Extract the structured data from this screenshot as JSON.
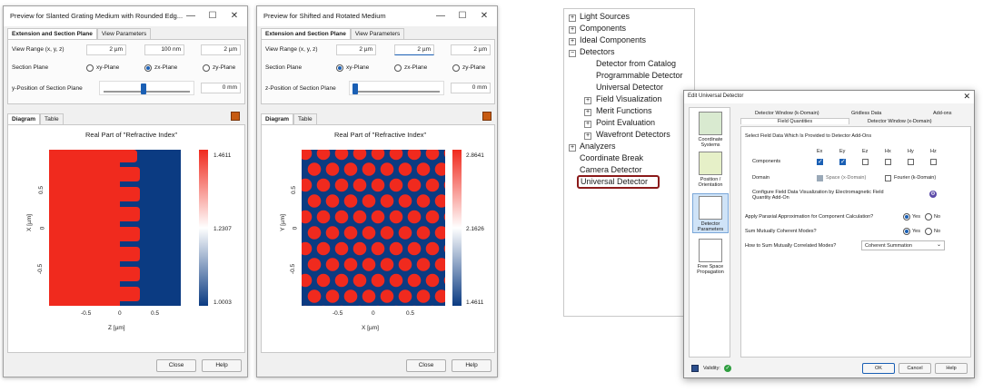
{
  "win1": {
    "title": "Preview for Slanted Grating Medium with Rounded Edg...",
    "tabs": [
      "Extension and Section Plane",
      "View Parameters"
    ],
    "view_range_label": "View Range (x, y, z)",
    "view_range": [
      "2 µm",
      "100 nm",
      "2 µm"
    ],
    "section_plane_label": "Section Plane",
    "planes": [
      "xy-Plane",
      "zx-Plane",
      "zy-Plane"
    ],
    "position_label": "y-Position of Section Plane",
    "position_value": "0 mm",
    "position_fraction": 0.42,
    "diagram_tabs": [
      "Diagram",
      "Table"
    ],
    "plot_title": "Real Part of \"Refractive Index\"",
    "ylabel": "X [µm]",
    "xlabel": "Z [µm]",
    "yticks": [
      "0.5",
      "0",
      "-0.5"
    ],
    "xticks": [
      "-0.5",
      "0",
      "0.5"
    ],
    "colorbar": [
      "1.4611",
      "1.2307",
      "1.0003"
    ],
    "close": "Close",
    "help": "Help"
  },
  "win2": {
    "title": "Preview for Shifted and Rotated Medium",
    "tabs": [
      "Extension and Section Plane",
      "View Parameters"
    ],
    "view_range_label": "View Range (x, y, z)",
    "view_range": [
      "2 µm",
      "2 µm",
      "2 µm"
    ],
    "section_plane_label": "Section Plane",
    "planes": [
      "xy-Plane",
      "zx-Plane",
      "zy-Plane"
    ],
    "position_label": "z-Position of Section Plane",
    "position_value": "0 mm",
    "position_fraction": 0.02,
    "diagram_tabs": [
      "Diagram",
      "Table"
    ],
    "plot_title": "Real Part of \"Refractive Index\"",
    "ylabel": "Y [µm]",
    "xlabel": "X [µm]",
    "yticks": [
      "0.5",
      "0",
      "-0.5"
    ],
    "xticks": [
      "-0.5",
      "0",
      "0.5"
    ],
    "colorbar": [
      "2.8641",
      "2.1626",
      "1.4611"
    ],
    "close": "Close",
    "help": "Help"
  },
  "tree": {
    "items": [
      "Light Sources",
      "Components",
      "Ideal Components",
      "Detectors",
      "Detector from Catalog",
      "Programmable Detector",
      "Universal Detector",
      "Field Visualization",
      "Merit Functions",
      "Point Evaluation",
      "Wavefront Detectors",
      "Analyzers",
      "Coordinate Break",
      "Camera Detector",
      "Universal Detector"
    ]
  },
  "dlg": {
    "title": "Edit Universal Detector",
    "close_glyph": "✕",
    "side": [
      "Coordinate Systems",
      "Position / Orientation",
      "Detector Parameters",
      "Free Space Propagation"
    ],
    "tabs_top": [
      "Detector Window (k-Domain)",
      "Gridless Data",
      "Add-ons"
    ],
    "tabs_bottom": [
      "Field Quantities",
      "Detector Window (x-Domain)"
    ],
    "section_label": "Select Field Data Which Is Provided to Detector Add-Ons",
    "components_label": "Components",
    "components": [
      "Ex",
      "Ey",
      "Ez",
      "Hx",
      "Hy",
      "Hz"
    ],
    "components_checked": [
      true,
      true,
      false,
      false,
      false,
      false
    ],
    "domain_label": "Domain",
    "domain_space": "Space (x-Domain)",
    "domain_fourier": "Fourier (k-Domain)",
    "configure_label": "Configure Field Data Visualization by Electromagnetic Field Quantity Add-On",
    "paraxial_label": "Apply Paraxial Approximation for Component Calculation?",
    "coherent_label": "Sum Mutually Coherent Modes?",
    "correlated_label": "How to Sum Mutually Correlated Modes?",
    "correlated_value": "Coherent Summation",
    "yes": "Yes",
    "no": "No",
    "validity": "Validity:",
    "ok": "OK",
    "cancel": "Cancel",
    "help": "Help"
  },
  "colors": {
    "red": "#f02a1e",
    "blue": "#0b3b82",
    "accent": "#1a5fb4",
    "highlight_box": "#8b1a1a"
  }
}
